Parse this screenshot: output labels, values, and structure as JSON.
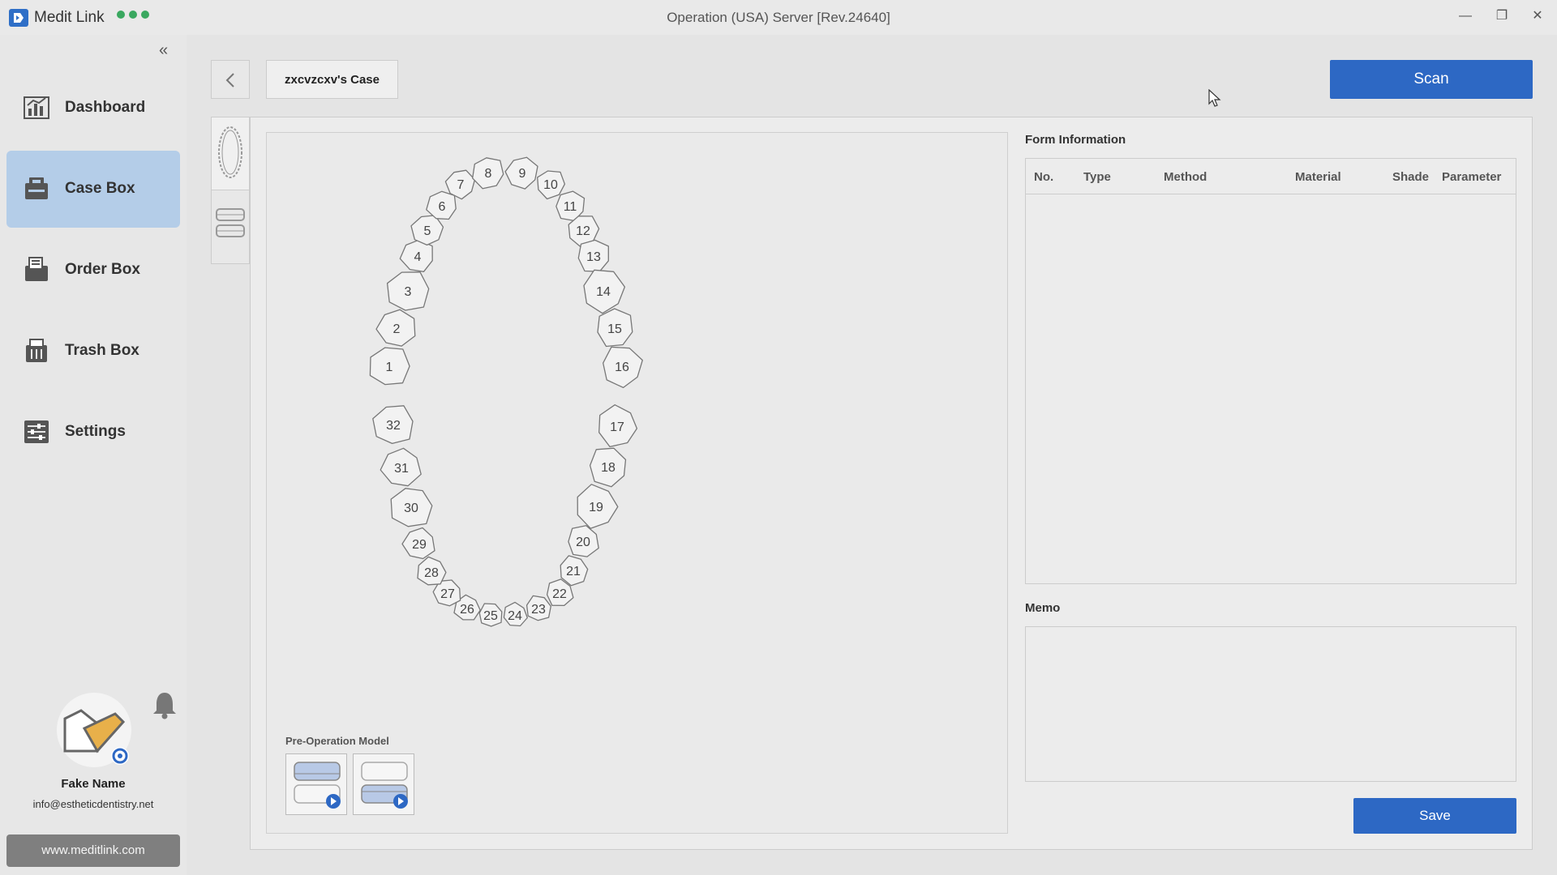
{
  "app": {
    "name": "Medit Link",
    "window_title": "Operation (USA) Server [Rev.24640]"
  },
  "window_controls": {
    "minimize": "—",
    "maximize": "❐",
    "close": "✕"
  },
  "sidebar": {
    "collapse": "«",
    "items": [
      {
        "label": "Dashboard",
        "icon": "dashboard-icon"
      },
      {
        "label": "Case Box",
        "icon": "case-box-icon",
        "active": true
      },
      {
        "label": "Order Box",
        "icon": "order-box-icon"
      },
      {
        "label": "Trash Box",
        "icon": "trash-box-icon"
      },
      {
        "label": "Settings",
        "icon": "settings-icon"
      }
    ],
    "user": {
      "name": "Fake Name",
      "email": "info@estheticdentistry.net"
    },
    "website": "www.meditlink.com"
  },
  "toolbar": {
    "case_tab": "zxcvzcxv's Case",
    "scan_label": "Scan"
  },
  "tooth_chart": {
    "teeth": [
      "1",
      "2",
      "3",
      "4",
      "5",
      "6",
      "7",
      "8",
      "9",
      "10",
      "11",
      "12",
      "13",
      "14",
      "15",
      "16",
      "17",
      "18",
      "19",
      "20",
      "21",
      "22",
      "23",
      "24",
      "25",
      "26",
      "27",
      "28",
      "29",
      "30",
      "31",
      "32"
    ]
  },
  "pre_operation": {
    "label": "Pre-Operation Model"
  },
  "form": {
    "title": "Form Information",
    "columns": [
      "No.",
      "Type",
      "Method",
      "Material",
      "Shade",
      "Parameter"
    ]
  },
  "memo": {
    "title": "Memo",
    "value": ""
  },
  "save_label": "Save",
  "colors": {
    "accent": "#2d68c4",
    "active_nav": "#b4cde8",
    "status_dots": "#3aa860"
  }
}
